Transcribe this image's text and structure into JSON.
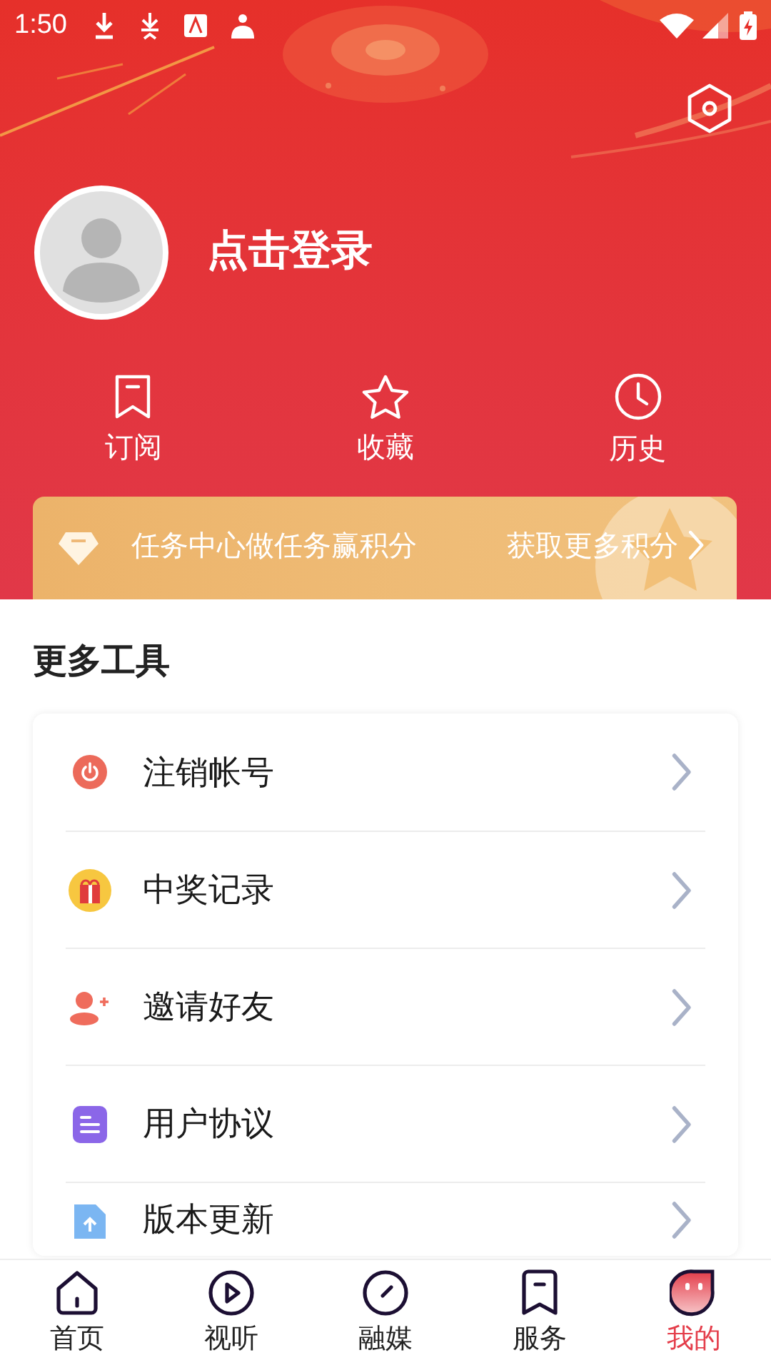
{
  "status_bar": {
    "time": "1:50"
  },
  "profile": {
    "login_label": "点击登录"
  },
  "quick_actions": [
    {
      "kind": "bookmark",
      "label": "订阅"
    },
    {
      "kind": "star",
      "label": "收藏"
    },
    {
      "kind": "clock",
      "label": "历史"
    }
  ],
  "task_banner": {
    "title": "任务中心做任务赢积分",
    "action": "获取更多积分"
  },
  "tools": {
    "title": "更多工具",
    "items": [
      {
        "kind": "power",
        "label": "注销帐号"
      },
      {
        "kind": "gift",
        "label": "中奖记录"
      },
      {
        "kind": "invite",
        "label": "邀请好友"
      },
      {
        "kind": "document",
        "label": "用户协议"
      },
      {
        "kind": "update",
        "label": "版本更新"
      }
    ]
  },
  "bottom_nav": [
    {
      "kind": "home",
      "label": "首页",
      "selected": false
    },
    {
      "kind": "play",
      "label": "视听",
      "selected": false
    },
    {
      "kind": "gauge",
      "label": "融媒",
      "selected": false
    },
    {
      "kind": "bookmark",
      "label": "服务",
      "selected": false
    },
    {
      "kind": "mine",
      "label": "我的",
      "selected": true
    }
  ]
}
